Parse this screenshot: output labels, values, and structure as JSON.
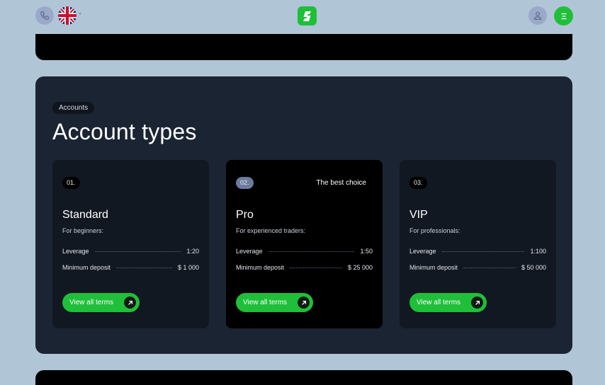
{
  "header": {
    "icons": [
      "phone-icon",
      "uk-flag-icon",
      "chevron-down-icon",
      "logo-icon",
      "user-icon",
      "menu-icon"
    ],
    "colors": {
      "accent": "#1fbf3a",
      "icon_bg": "#9aa9c9"
    }
  },
  "section": {
    "pill": "Accounts",
    "title": "Account types"
  },
  "cards": [
    {
      "number": "01.",
      "badge": "",
      "title": "Standard",
      "subtitle": "For beginners:",
      "leverage_label": "Leverage",
      "leverage_value": "1:20",
      "deposit_label": "Minimum deposit",
      "deposit_value": "$ 1 000",
      "button": "View all terms"
    },
    {
      "number": "02.",
      "badge": "The best choice",
      "title": "Pro",
      "subtitle": "For experienced traders:",
      "leverage_label": "Leverage",
      "leverage_value": "1:50",
      "deposit_label": "Minimum deposit",
      "deposit_value": "$ 25 000",
      "button": "View all terms"
    },
    {
      "number": "03.",
      "badge": "",
      "title": "VIP",
      "subtitle": "For professionals:",
      "leverage_label": "Leverage",
      "leverage_value": "1:100",
      "deposit_label": "Minimum deposit",
      "deposit_value": "$ 50 000",
      "button": "View all terms"
    }
  ]
}
